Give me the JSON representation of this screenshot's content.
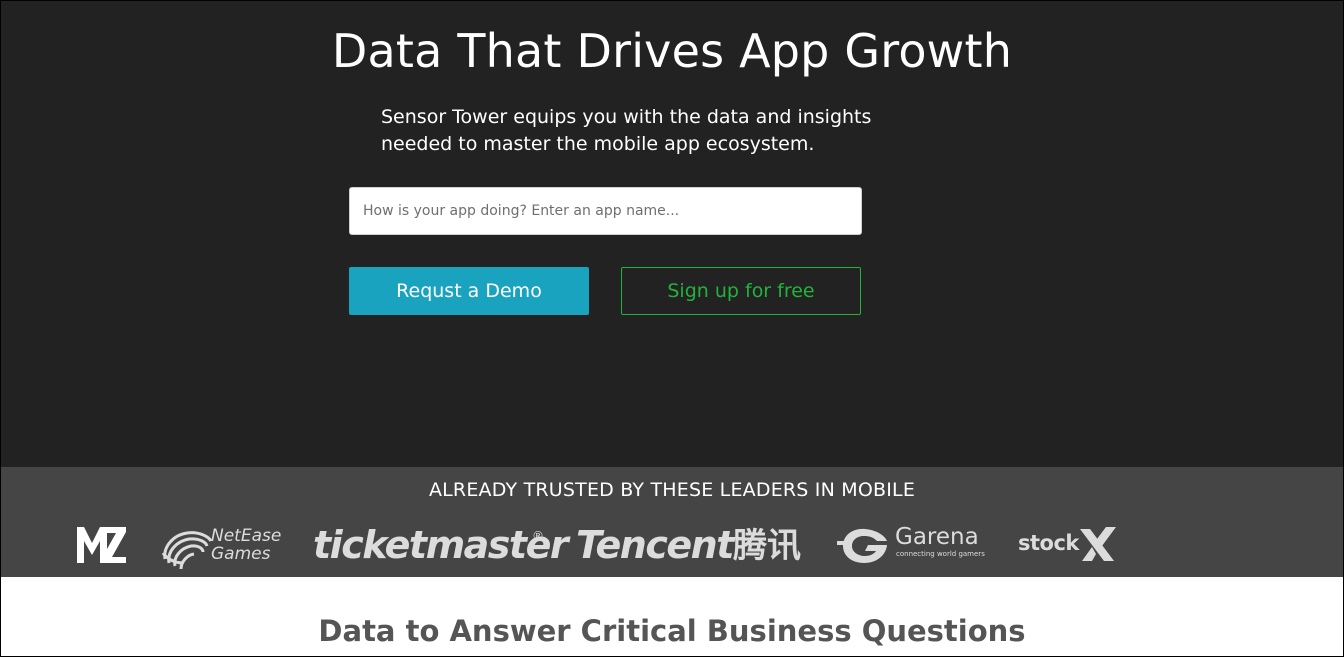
{
  "hero": {
    "title": "Data That Drives App Growth",
    "subtitle": "Sensor Tower equips you with the data and insights needed to master the mobile app ecosystem.",
    "search": {
      "value": "",
      "placeholder": "How is your app doing? Enter an app name..."
    },
    "demo_button_label": "Requst a Demo",
    "signup_button_label": "Sign up for free"
  },
  "trusted": {
    "title": "ALREADY TRUSTED BY THESE LEADERS IN MOBILE",
    "logos": [
      {
        "name": "MZ",
        "icon": "mz-logo"
      },
      {
        "name": "NetEase Games",
        "line1": "NetEase",
        "line2": "Games",
        "icon": "netease-games-logo"
      },
      {
        "name": "ticketmaster",
        "text": "ticketmaster",
        "mark": "®",
        "icon": "ticketmaster-logo"
      },
      {
        "name": "Tencent",
        "text": "Tencent",
        "cn": "腾讯",
        "icon": "tencent-logo"
      },
      {
        "name": "Garena",
        "text": "Garena",
        "tagline": "connecting world gamers",
        "icon": "garena-logo"
      },
      {
        "name": "stockX",
        "text": "stock",
        "icon": "stockx-logo"
      }
    ]
  },
  "section": {
    "title": "Data to Answer Critical Business Questions"
  },
  "colors": {
    "hero_bg": "#222222",
    "trusted_bg": "#454545",
    "demo_button": "#1aa3bf",
    "signup_accent": "#23b23a",
    "section_title": "#555555"
  }
}
